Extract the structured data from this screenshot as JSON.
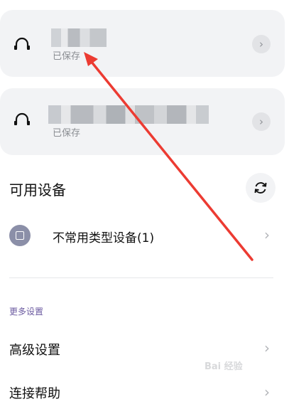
{
  "devices": [
    {
      "icon": "headphones-icon",
      "name": "",
      "status": "已保存"
    },
    {
      "icon": "headphones-icon",
      "name": "",
      "status": "已保存"
    }
  ],
  "available": {
    "title": "可用设备",
    "refresh_icon": "refresh-icon"
  },
  "device_row": {
    "label": "不常用类型设备(1)",
    "icon": "device-icon"
  },
  "more_settings": {
    "title": "更多设置",
    "items": [
      {
        "label": "高级设置"
      },
      {
        "label": "连接帮助"
      }
    ]
  },
  "watermark": "Bai 经验",
  "colors": {
    "annotation_arrow": "#ec3b32",
    "section_title": "#6b5aa0"
  }
}
